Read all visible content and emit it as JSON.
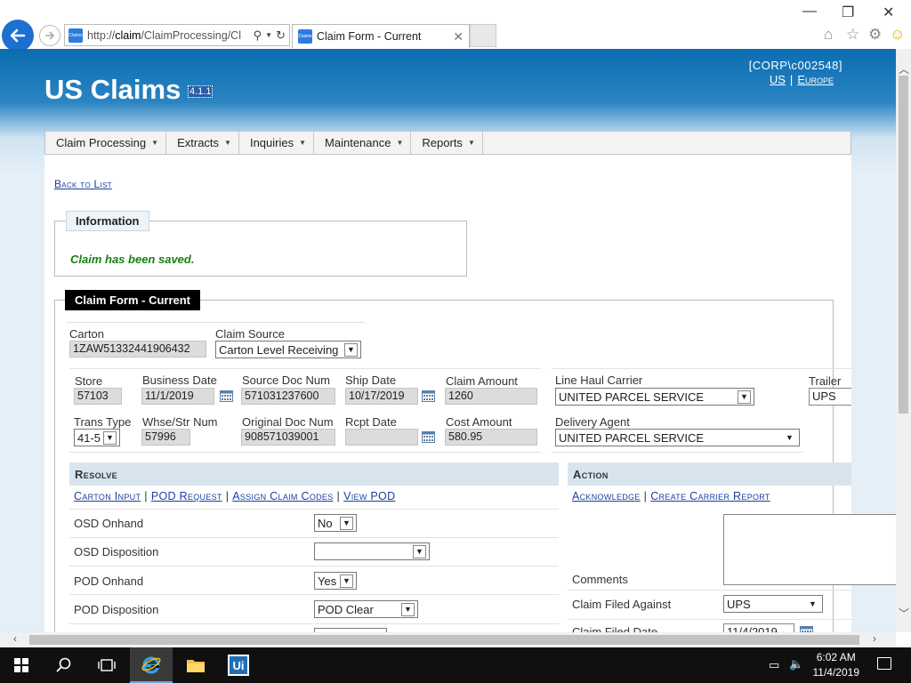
{
  "browser": {
    "url_prefix": "http://",
    "url_host": "claim",
    "url_rest": "/ClaimProcessing/Cl",
    "favicon_label": "Claims",
    "tab_title": "Claim Form - Current",
    "window_controls": {
      "minimize": "—",
      "restore": "❐",
      "close": "✕"
    }
  },
  "header": {
    "app_title": "US Claims",
    "version": "4.1.1",
    "user": "[CORP\\c002548]",
    "regions": [
      "US",
      "Europe"
    ]
  },
  "menu": [
    {
      "label": "Claim Processing"
    },
    {
      "label": "Extracts"
    },
    {
      "label": "Inquiries"
    },
    {
      "label": "Maintenance"
    },
    {
      "label": "Reports"
    }
  ],
  "back_link": "Back to List",
  "information": {
    "heading": "Information",
    "message": "Claim has been saved."
  },
  "claim_form": {
    "heading": "Claim Form - Current",
    "carton": {
      "label": "Carton",
      "value": "1ZAW51332441906432"
    },
    "claim_source": {
      "label": "Claim Source",
      "value": "Carton Level Receiving"
    },
    "store": {
      "label": "Store",
      "value": "57103"
    },
    "business_date": {
      "label": "Business Date",
      "value": "11/1/2019"
    },
    "source_doc_num": {
      "label": "Source Doc Num",
      "value": "571031237600"
    },
    "ship_date": {
      "label": "Ship Date",
      "value": "10/17/2019"
    },
    "claim_amount": {
      "label": "Claim Amount",
      "value": "1260"
    },
    "line_haul_carrier": {
      "label": "Line Haul Carrier",
      "value": "UNITED PARCEL SERVICE"
    },
    "trailer": {
      "label": "Trailer",
      "value": "UPS"
    },
    "trans_type": {
      "label": "Trans Type",
      "value": "41-5"
    },
    "whse_str_num": {
      "label": "Whse/Str Num",
      "value": "57996"
    },
    "original_doc_num": {
      "label": "Original Doc Num",
      "value": "908571039001"
    },
    "rcpt_date": {
      "label": "Rcpt Date",
      "value": ""
    },
    "cost_amount": {
      "label": "Cost Amount",
      "value": "580.95"
    },
    "delivery_agent": {
      "label": "Delivery Agent",
      "value": "UNITED PARCEL SERVICE"
    }
  },
  "resolve": {
    "heading": "Resolve",
    "links": [
      "Carton Input",
      "POD Request",
      "Assign Claim Codes",
      "View POD"
    ],
    "rows": [
      {
        "label": "OSD Onhand",
        "value": "No"
      },
      {
        "label": "OSD Disposition",
        "value": ""
      },
      {
        "label": "POD Onhand",
        "value": "Yes"
      },
      {
        "label": "POD Disposition",
        "value": "POD Clear"
      }
    ]
  },
  "action": {
    "heading": "Action",
    "links": [
      "Acknowledge",
      "Create Carrier Report"
    ],
    "comments_label": "Comments",
    "comments_value": "",
    "claim_filed_against": {
      "label": "Claim Filed Against",
      "value": "UPS"
    },
    "claim_filed_date": {
      "label": "Claim Filed Date",
      "value": "11/4/2019"
    }
  },
  "taskbar": {
    "time": "6:02 AM",
    "date": "11/4/2019"
  },
  "colors": {
    "header_blue": "#0b6db1",
    "link_blue": "#1a3fa0",
    "success_green": "#158015",
    "section_bar": "#d9e5ee"
  }
}
